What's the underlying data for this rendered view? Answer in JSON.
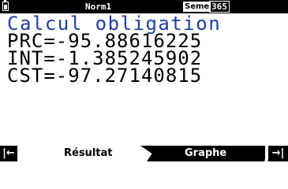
{
  "status_bar": {
    "mode": "Norm1",
    "days_label": "Seme",
    "days_value": "365",
    "battery_icon": "battery-icon"
  },
  "display": {
    "title": "Calcul obligation",
    "lines": [
      "PRC=-95.88616225",
      "INT=-1.385245902",
      "CST=-97.27140815"
    ]
  },
  "function_bar": {
    "left_arrow": "|←",
    "result_label": "Résultat",
    "graph_label": "Graphe",
    "right_arrow": "→|"
  },
  "colors": {
    "title": "#1f3ea8",
    "bar_background": "#000000",
    "text": "#000000"
  }
}
